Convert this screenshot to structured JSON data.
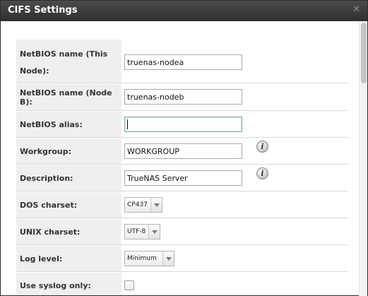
{
  "dialog": {
    "title": "CIFS Settings",
    "close_glyph": "✕"
  },
  "form": {
    "netbios_name": {
      "label": "NetBIOS name (This Node):",
      "value": "truenas-nodea"
    },
    "netbios_name_b": {
      "label": "NetBIOS name (Node B):",
      "value": "truenas-nodeb"
    },
    "netbios_alias": {
      "label": "NetBIOS alias:",
      "value": ""
    },
    "workgroup": {
      "label": "Workgroup:",
      "value": "WORKGROUP",
      "help_icon": "info-icon"
    },
    "description": {
      "label": "Description:",
      "value": "TrueNAS Server",
      "help_icon": "info-icon"
    },
    "dos_charset": {
      "label": "DOS charset:",
      "value": "CP437"
    },
    "unix_charset": {
      "label": "UNIX charset:",
      "value": "UTF-8"
    },
    "log_level": {
      "label": "Log level:",
      "value": "Minimum"
    },
    "use_syslog": {
      "label": "Use syslog only:",
      "checked": false
    }
  },
  "info_glyph": "i"
}
